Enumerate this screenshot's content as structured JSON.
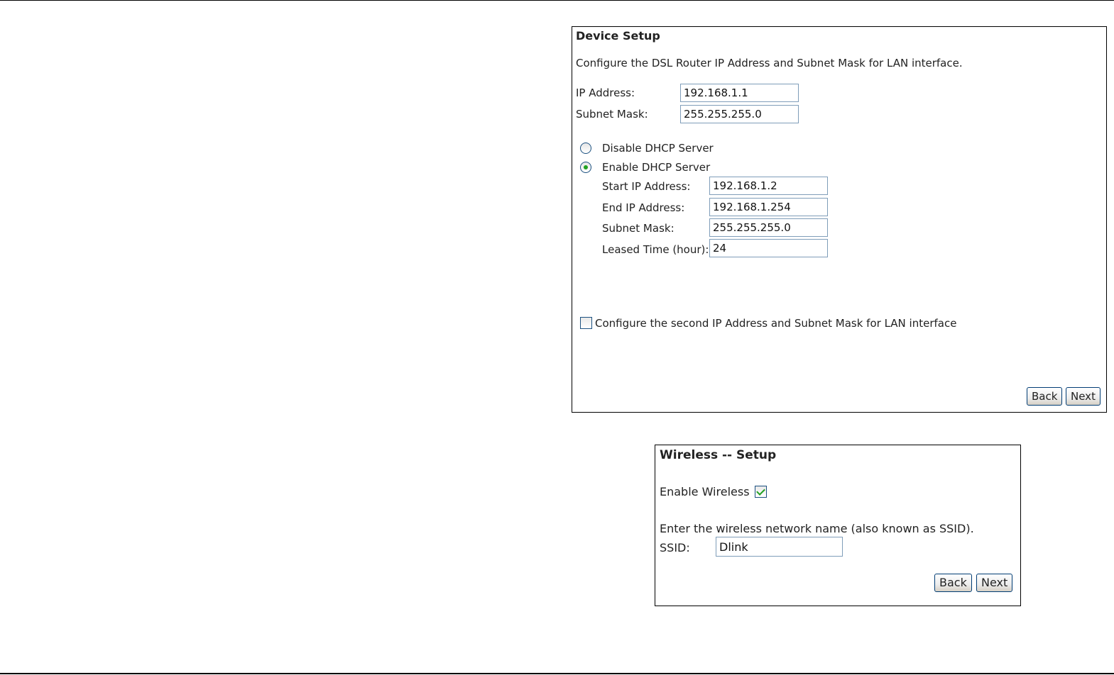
{
  "device_setup": {
    "title": "Device Setup",
    "description": "Configure the DSL Router IP Address and Subnet Mask for LAN interface.",
    "ip_address_label": "IP Address:",
    "ip_address_value": "192.168.1.1",
    "subnet_mask_label": "Subnet Mask:",
    "subnet_mask_value": "255.255.255.0",
    "dhcp": {
      "disable_label": "Disable DHCP Server",
      "enable_label": "Enable DHCP Server",
      "selected": "enable",
      "start_ip_label": "Start IP Address:",
      "start_ip_value": "192.168.1.2",
      "end_ip_label": "End IP Address:",
      "end_ip_value": "192.168.1.254",
      "subnet_mask_label": "Subnet Mask:",
      "subnet_mask_value": "255.255.255.0",
      "leased_time_label": "Leased Time (hour):",
      "leased_time_value": "24"
    },
    "second_ip_label": "Configure the second IP Address and Subnet Mask for LAN interface",
    "second_ip_checked": false,
    "back_label": "Back",
    "next_label": "Next"
  },
  "wireless_setup": {
    "title": "Wireless -- Setup",
    "enable_label": "Enable Wireless",
    "enable_checked": true,
    "ssid_prompt": "Enter the wireless network name (also known as SSID).",
    "ssid_label": "SSID:",
    "ssid_value": "Dlink",
    "back_label": "Back",
    "next_label": "Next"
  },
  "colors": {
    "checkmark": "#21a121",
    "field_border": "#7f9db9",
    "button_border": "#003c74"
  }
}
